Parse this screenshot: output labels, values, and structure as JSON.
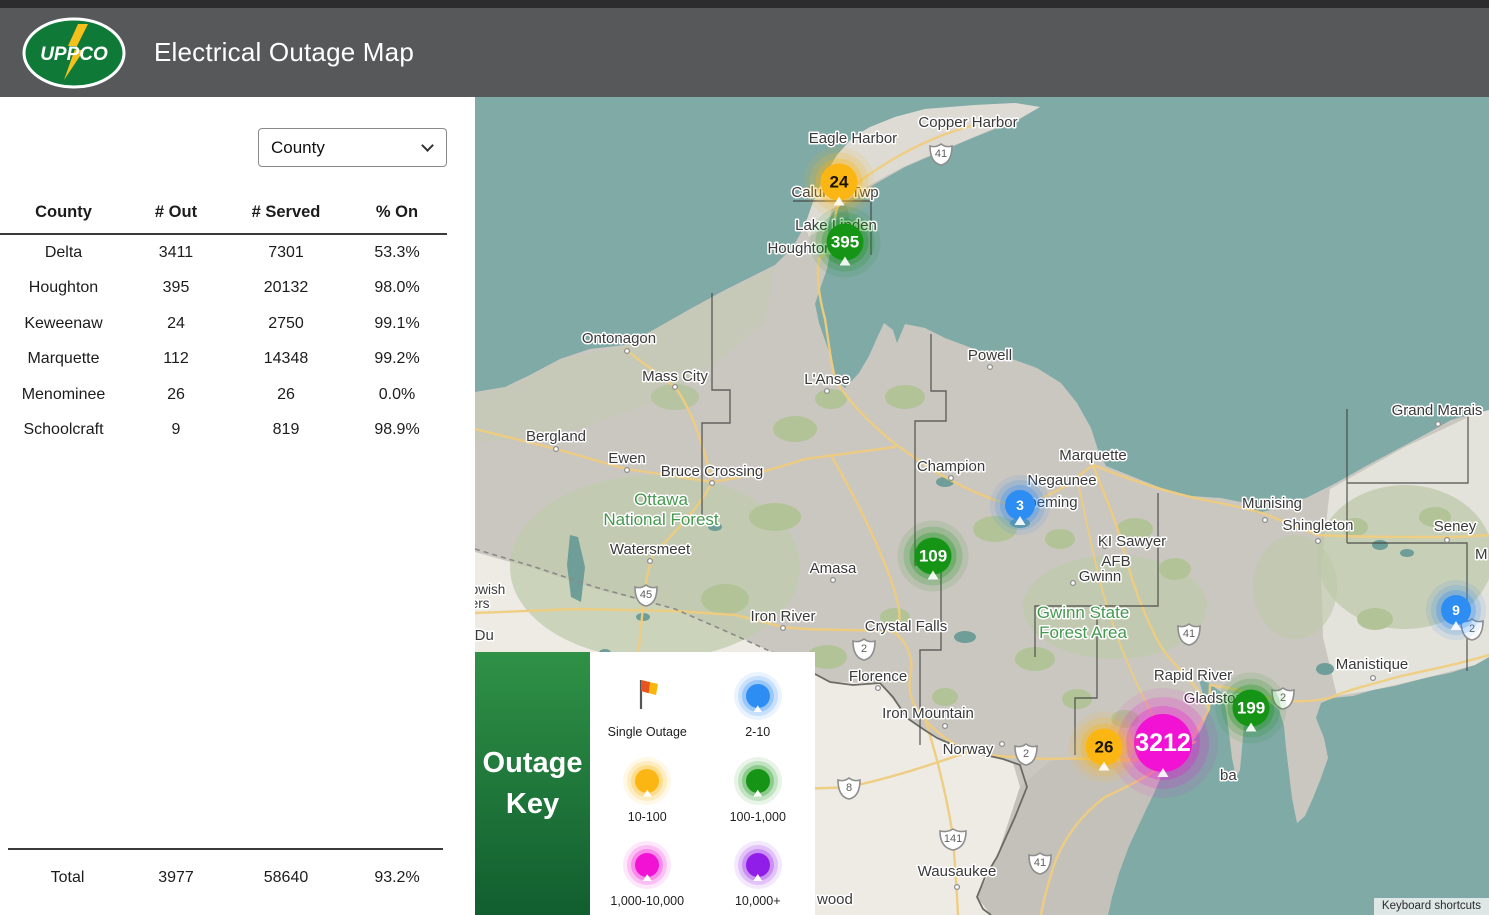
{
  "header": {
    "logo_text": "UPPCO",
    "title": "Electrical Outage Map"
  },
  "sidebar": {
    "view_select": {
      "value": "County"
    },
    "table": {
      "columns": [
        "County",
        "# Out",
        "# Served",
        "% On"
      ],
      "rows": [
        {
          "county": "Delta",
          "out": "3411",
          "served": "7301",
          "pct_on": "53.3%"
        },
        {
          "county": "Houghton",
          "out": "395",
          "served": "20132",
          "pct_on": "98.0%"
        },
        {
          "county": "Keweenaw",
          "out": "24",
          "served": "2750",
          "pct_on": "99.1%"
        },
        {
          "county": "Marquette",
          "out": "112",
          "served": "14348",
          "pct_on": "99.2%"
        },
        {
          "county": "Menominee",
          "out": "26",
          "served": "26",
          "pct_on": "0.0%"
        },
        {
          "county": "Schoolcraft",
          "out": "9",
          "served": "819",
          "pct_on": "98.9%"
        }
      ],
      "total": {
        "label": "Total",
        "out": "3977",
        "served": "58640",
        "pct_on": "93.2%"
      }
    }
  },
  "legend": {
    "title_line1": "Outage",
    "title_line2": "Key",
    "items": [
      {
        "label": "Single Outage",
        "icon": "single-outage-flag"
      },
      {
        "label": "2-10",
        "color": "#2e8df3"
      },
      {
        "label": "10-100",
        "color": "#fcb614"
      },
      {
        "label": "100-1,000",
        "color": "#169416"
      },
      {
        "label": "1,000-10,000",
        "color": "#f112d4"
      },
      {
        "label": "10,000+",
        "color": "#911ee8"
      }
    ]
  },
  "map": {
    "attribution": "Keyboard shortcuts",
    "markers": [
      {
        "count": "24",
        "category": "10-100"
      },
      {
        "count": "395",
        "category": "100-1,000"
      },
      {
        "count": "3",
        "category": "2-10"
      },
      {
        "count": "109",
        "category": "100-1,000"
      },
      {
        "count": "9",
        "category": "2-10"
      },
      {
        "count": "199",
        "category": "100-1,000"
      },
      {
        "count": "26",
        "category": "10-100"
      },
      {
        "count": "3212",
        "category": "1,000-10,000"
      }
    ],
    "labels": [
      "Copper Harbor",
      "Eagle Harbor",
      "Calumet Twp",
      "Lake Linden",
      "Houghton",
      "Ontonagon",
      "Mass City",
      "Powell",
      "L'Anse",
      "Bergland",
      "Ewen",
      "Bruce Crossing",
      "Marquette",
      "Champion",
      "Negaunee",
      "Ishpeming",
      "Ottawa",
      "National Forest",
      "KI Sawyer",
      "AFB",
      "Munising",
      "Shingleton",
      "Seney",
      "Grand Marais",
      "Watersmeet",
      "Amasa",
      "Gwinn",
      "Iron River",
      "Crystal Falls",
      "Gwinn State",
      "Forest Area",
      "Manistique",
      "Florence",
      "Iron Mountain",
      "Rapid River",
      "Gladstone",
      "Norway",
      "Wausaukee",
      "wood",
      "towish",
      "ters",
      "c Du",
      "ba",
      "M"
    ],
    "shields": [
      "41",
      "45",
      "2",
      "41",
      "2",
      "8",
      "141",
      "41",
      "2",
      "2"
    ]
  },
  "colors": {
    "header_bg": "#57585a",
    "logo_green": "#0f7a38",
    "water": "#7faaa6",
    "land": "#cac7c0",
    "legend_green_top": "#2f9146",
    "legend_green_bottom": "#115e2f"
  }
}
